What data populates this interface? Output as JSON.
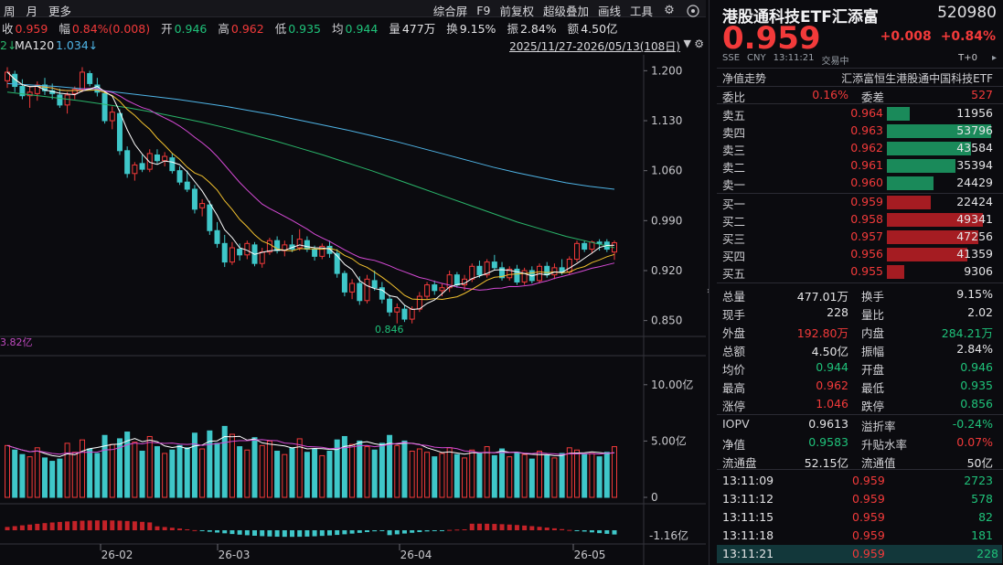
{
  "toolbar": {
    "left_items": [
      "周",
      "月",
      "更多"
    ],
    "right_items": [
      "综合屏",
      "F9",
      "前复权",
      "超级叠加",
      "画线",
      "工具"
    ],
    "icons": [
      "gear-icon",
      "settings-icon"
    ]
  },
  "quote_strip": [
    {
      "label": "收",
      "value": "0.959",
      "color": "red"
    },
    {
      "label": "幅",
      "value": "0.84%(0.008)",
      "color": "red"
    },
    {
      "label": "开",
      "value": "0.946",
      "color": "green"
    },
    {
      "label": "高",
      "value": "0.962",
      "color": "red"
    },
    {
      "label": "低",
      "value": "0.935",
      "color": "green"
    },
    {
      "label": "均",
      "value": "0.944",
      "color": "green"
    },
    {
      "label": "量",
      "value": "477万",
      "color": "white"
    },
    {
      "label": "换",
      "value": "9.15%",
      "color": "white"
    },
    {
      "label": "振",
      "value": "2.84%",
      "color": "white"
    },
    {
      "label": "额",
      "value": "4.50亿",
      "color": "white"
    }
  ],
  "ma_strip": {
    "left_fragment": "2↓",
    "ma120_label": "MA120",
    "ma120_value": "1.034↓",
    "range": "2025/11/27-2026/05/13(108日)"
  },
  "chart_data": {
    "type": "candlestick",
    "price_axis": {
      "ticks": [
        "1.200",
        "1.130",
        "1.060",
        "0.990",
        "0.920",
        "0.850"
      ],
      "min": 0.838,
      "max": 1.212
    },
    "low_label": "0.846",
    "volume_axis": {
      "ticks": [
        "10.00亿",
        "5.00亿",
        "0"
      ],
      "max": 12.5
    },
    "volume_left_label": "3.82亿",
    "macd_axis_label": "-1.16亿",
    "x_labels": [
      "26-02",
      "26-03",
      "26-04",
      "26-05"
    ],
    "candles": [
      {
        "o": 1.186,
        "h": 1.205,
        "l": 1.176,
        "c": 1.198,
        "v": 4.6
      },
      {
        "o": 1.195,
        "h": 1.2,
        "l": 1.17,
        "c": 1.178,
        "v": 4.2
      },
      {
        "o": 1.178,
        "h": 1.188,
        "l": 1.16,
        "c": 1.165,
        "v": 3.8
      },
      {
        "o": 1.165,
        "h": 1.178,
        "l": 1.148,
        "c": 1.17,
        "v": 3.6
      },
      {
        "o": 1.168,
        "h": 1.185,
        "l": 1.158,
        "c": 1.18,
        "v": 4.4
      },
      {
        "o": 1.18,
        "h": 1.19,
        "l": 1.166,
        "c": 1.172,
        "v": 3.5
      },
      {
        "o": 1.172,
        "h": 1.182,
        "l": 1.16,
        "c": 1.168,
        "v": 3.2
      },
      {
        "o": 1.166,
        "h": 1.175,
        "l": 1.148,
        "c": 1.152,
        "v": 3.4
      },
      {
        "o": 1.152,
        "h": 1.17,
        "l": 1.14,
        "c": 1.166,
        "v": 4.8
      },
      {
        "o": 1.168,
        "h": 1.178,
        "l": 1.16,
        "c": 1.174,
        "v": 4.0
      },
      {
        "o": 1.174,
        "h": 1.205,
        "l": 1.17,
        "c": 1.198,
        "v": 5.1
      },
      {
        "o": 1.196,
        "h": 1.2,
        "l": 1.178,
        "c": 1.182,
        "v": 4.3
      },
      {
        "o": 1.18,
        "h": 1.19,
        "l": 1.164,
        "c": 1.17,
        "v": 3.9
      },
      {
        "o": 1.168,
        "h": 1.172,
        "l": 1.126,
        "c": 1.13,
        "v": 5.5
      },
      {
        "o": 1.13,
        "h": 1.15,
        "l": 1.118,
        "c": 1.142,
        "v": 4.7
      },
      {
        "o": 1.14,
        "h": 1.146,
        "l": 1.082,
        "c": 1.088,
        "v": 5.2
      },
      {
        "o": 1.088,
        "h": 1.094,
        "l": 1.05,
        "c": 1.056,
        "v": 5.8
      },
      {
        "o": 1.056,
        "h": 1.072,
        "l": 1.046,
        "c": 1.068,
        "v": 4.9
      },
      {
        "o": 1.07,
        "h": 1.082,
        "l": 1.058,
        "c": 1.062,
        "v": 4.1
      },
      {
        "o": 1.062,
        "h": 1.09,
        "l": 1.058,
        "c": 1.084,
        "v": 5.4
      },
      {
        "o": 1.082,
        "h": 1.09,
        "l": 1.07,
        "c": 1.074,
        "v": 4.5
      },
      {
        "o": 1.074,
        "h": 1.086,
        "l": 1.066,
        "c": 1.08,
        "v": 3.9
      },
      {
        "o": 1.078,
        "h": 1.084,
        "l": 1.056,
        "c": 1.06,
        "v": 4.2
      },
      {
        "o": 1.06,
        "h": 1.066,
        "l": 1.04,
        "c": 1.044,
        "v": 4.6
      },
      {
        "o": 1.044,
        "h": 1.06,
        "l": 1.03,
        "c": 1.034,
        "v": 4.4
      },
      {
        "o": 1.034,
        "h": 1.04,
        "l": 1.0,
        "c": 1.006,
        "v": 5.7
      },
      {
        "o": 1.008,
        "h": 1.02,
        "l": 0.996,
        "c": 1.014,
        "v": 4.3
      },
      {
        "o": 1.012,
        "h": 1.018,
        "l": 0.97,
        "c": 0.976,
        "v": 5.9
      },
      {
        "o": 0.976,
        "h": 0.988,
        "l": 0.952,
        "c": 0.958,
        "v": 4.8
      },
      {
        "o": 0.958,
        "h": 0.97,
        "l": 0.925,
        "c": 0.932,
        "v": 6.3
      },
      {
        "o": 0.932,
        "h": 0.96,
        "l": 0.928,
        "c": 0.952,
        "v": 5.6
      },
      {
        "o": 0.95,
        "h": 0.958,
        "l": 0.934,
        "c": 0.942,
        "v": 4.5
      },
      {
        "o": 0.942,
        "h": 0.962,
        "l": 0.936,
        "c": 0.958,
        "v": 4.2
      },
      {
        "o": 0.956,
        "h": 0.96,
        "l": 0.926,
        "c": 0.93,
        "v": 5.3
      },
      {
        "o": 0.93,
        "h": 0.952,
        "l": 0.924,
        "c": 0.946,
        "v": 4.6
      },
      {
        "o": 0.946,
        "h": 0.966,
        "l": 0.942,
        "c": 0.962,
        "v": 5.0
      },
      {
        "o": 0.962,
        "h": 0.968,
        "l": 0.944,
        "c": 0.948,
        "v": 4.1
      },
      {
        "o": 0.948,
        "h": 0.962,
        "l": 0.94,
        "c": 0.956,
        "v": 3.8
      },
      {
        "o": 0.956,
        "h": 0.97,
        "l": 0.946,
        "c": 0.95,
        "v": 4.4
      },
      {
        "o": 0.952,
        "h": 0.978,
        "l": 0.948,
        "c": 0.964,
        "v": 5.2
      },
      {
        "o": 0.962,
        "h": 0.968,
        "l": 0.946,
        "c": 0.95,
        "v": 4.0
      },
      {
        "o": 0.95,
        "h": 0.955,
        "l": 0.934,
        "c": 0.94,
        "v": 4.3
      },
      {
        "o": 0.94,
        "h": 0.958,
        "l": 0.936,
        "c": 0.954,
        "v": 3.7
      },
      {
        "o": 0.954,
        "h": 0.962,
        "l": 0.938,
        "c": 0.944,
        "v": 4.1
      },
      {
        "o": 0.944,
        "h": 0.95,
        "l": 0.91,
        "c": 0.916,
        "v": 5.1
      },
      {
        "o": 0.916,
        "h": 0.92,
        "l": 0.884,
        "c": 0.89,
        "v": 5.4
      },
      {
        "o": 0.89,
        "h": 0.908,
        "l": 0.88,
        "c": 0.902,
        "v": 4.7
      },
      {
        "o": 0.902,
        "h": 0.912,
        "l": 0.872,
        "c": 0.878,
        "v": 5.0
      },
      {
        "o": 0.878,
        "h": 0.914,
        "l": 0.874,
        "c": 0.908,
        "v": 4.5
      },
      {
        "o": 0.906,
        "h": 0.92,
        "l": 0.892,
        "c": 0.896,
        "v": 4.2
      },
      {
        "o": 0.896,
        "h": 0.904,
        "l": 0.874,
        "c": 0.88,
        "v": 4.8
      },
      {
        "o": 0.88,
        "h": 0.886,
        "l": 0.856,
        "c": 0.862,
        "v": 5.5
      },
      {
        "o": 0.862,
        "h": 0.874,
        "l": 0.846,
        "c": 0.868,
        "v": 4.6
      },
      {
        "o": 0.866,
        "h": 0.872,
        "l": 0.848,
        "c": 0.852,
        "v": 5.0
      },
      {
        "o": 0.852,
        "h": 0.87,
        "l": 0.846,
        "c": 0.866,
        "v": 4.1
      },
      {
        "o": 0.866,
        "h": 0.89,
        "l": 0.862,
        "c": 0.884,
        "v": 4.3
      },
      {
        "o": 0.884,
        "h": 0.904,
        "l": 0.88,
        "c": 0.9,
        "v": 4.0
      },
      {
        "o": 0.9,
        "h": 0.906,
        "l": 0.886,
        "c": 0.892,
        "v": 3.6
      },
      {
        "o": 0.892,
        "h": 0.902,
        "l": 0.884,
        "c": 0.896,
        "v": 3.9
      },
      {
        "o": 0.896,
        "h": 0.92,
        "l": 0.89,
        "c": 0.914,
        "v": 4.4
      },
      {
        "o": 0.914,
        "h": 0.918,
        "l": 0.896,
        "c": 0.9,
        "v": 3.8
      },
      {
        "o": 0.9,
        "h": 0.914,
        "l": 0.892,
        "c": 0.908,
        "v": 3.5
      },
      {
        "o": 0.908,
        "h": 0.93,
        "l": 0.904,
        "c": 0.926,
        "v": 4.2
      },
      {
        "o": 0.926,
        "h": 0.934,
        "l": 0.91,
        "c": 0.914,
        "v": 3.9
      },
      {
        "o": 0.914,
        "h": 0.936,
        "l": 0.91,
        "c": 0.932,
        "v": 4.5
      },
      {
        "o": 0.932,
        "h": 0.942,
        "l": 0.92,
        "c": 0.924,
        "v": 3.7
      },
      {
        "o": 0.924,
        "h": 0.932,
        "l": 0.906,
        "c": 0.91,
        "v": 4.3
      },
      {
        "o": 0.91,
        "h": 0.926,
        "l": 0.906,
        "c": 0.922,
        "v": 3.6
      },
      {
        "o": 0.922,
        "h": 0.928,
        "l": 0.9,
        "c": 0.904,
        "v": 4.0
      },
      {
        "o": 0.904,
        "h": 0.924,
        "l": 0.9,
        "c": 0.92,
        "v": 3.8
      },
      {
        "o": 0.92,
        "h": 0.926,
        "l": 0.902,
        "c": 0.906,
        "v": 3.4
      },
      {
        "o": 0.906,
        "h": 0.93,
        "l": 0.902,
        "c": 0.926,
        "v": 4.1
      },
      {
        "o": 0.926,
        "h": 0.932,
        "l": 0.91,
        "c": 0.914,
        "v": 3.7
      },
      {
        "o": 0.914,
        "h": 0.93,
        "l": 0.908,
        "c": 0.924,
        "v": 3.5
      },
      {
        "o": 0.924,
        "h": 0.936,
        "l": 0.914,
        "c": 0.918,
        "v": 3.9
      },
      {
        "o": 0.918,
        "h": 0.94,
        "l": 0.914,
        "c": 0.936,
        "v": 4.4
      },
      {
        "o": 0.936,
        "h": 0.962,
        "l": 0.932,
        "c": 0.958,
        "v": 4.2
      },
      {
        "o": 0.958,
        "h": 0.962,
        "l": 0.946,
        "c": 0.95,
        "v": 3.8
      },
      {
        "o": 0.95,
        "h": 0.962,
        "l": 0.944,
        "c": 0.96,
        "v": 3.9
      },
      {
        "o": 0.96,
        "h": 0.964,
        "l": 0.948,
        "c": 0.958,
        "v": 3.6
      },
      {
        "o": 0.96,
        "h": 0.964,
        "l": 0.946,
        "c": 0.95,
        "v": 4.0
      },
      {
        "o": 0.946,
        "h": 0.962,
        "l": 0.935,
        "c": 0.959,
        "v": 4.5
      }
    ],
    "ma_series": [
      {
        "name": "MA5",
        "color": "#ffffff"
      },
      {
        "name": "MA10",
        "color": "#f2c12e"
      },
      {
        "name": "MA20",
        "color": "#d54ad5"
      },
      {
        "name": "MA60",
        "color": "#2ab56a"
      },
      {
        "name": "MA120",
        "color": "#4fb4e6"
      }
    ],
    "ma60_points": [
      1.17,
      1.166,
      1.162,
      1.158,
      1.153,
      1.148,
      1.142,
      1.135,
      1.128,
      1.12,
      1.111,
      1.102,
      1.092,
      1.082,
      1.071,
      1.06,
      1.048,
      1.036,
      1.024,
      1.012,
      1.0,
      0.988,
      0.978,
      0.968,
      0.96,
      0.952
    ],
    "ma120_points": [
      1.182,
      1.18,
      1.178,
      1.175,
      1.172,
      1.168,
      1.164,
      1.16,
      1.155,
      1.15,
      1.144,
      1.138,
      1.131,
      1.124,
      1.117,
      1.109,
      1.101,
      1.092,
      1.083,
      1.074,
      1.065,
      1.057,
      1.05,
      1.043,
      1.038,
      1.034
    ]
  },
  "panel": {
    "name": "港股通科技ETF汇添富",
    "code": "520980",
    "price": "0.959",
    "change": "+0.008",
    "change_pct": "+0.84%",
    "meta": [
      "SSE",
      "CNY",
      "13:11:21",
      "交易中",
      "T+0",
      "▸"
    ],
    "net_label": "净值走势",
    "net_index": "汇添富恒生港股通中国科技ETF",
    "commission": {
      "label1": "委比",
      "value1": "0.16%",
      "label2": "委差",
      "value2": "527"
    },
    "asks": [
      {
        "label": "卖五",
        "price": "0.964",
        "volume": "11956",
        "bar": 0.22
      },
      {
        "label": "卖四",
        "price": "0.963",
        "volume": "53796",
        "bar": 1.0
      },
      {
        "label": "卖三",
        "price": "0.962",
        "volume": "43584",
        "bar": 0.81
      },
      {
        "label": "卖二",
        "price": "0.961",
        "volume": "35394",
        "bar": 0.66
      },
      {
        "label": "卖一",
        "price": "0.960",
        "volume": "24429",
        "bar": 0.45
      }
    ],
    "bids": [
      {
        "label": "买一",
        "price": "0.959",
        "volume": "22424",
        "bar": 0.42
      },
      {
        "label": "买二",
        "price": "0.958",
        "volume": "49341",
        "bar": 0.92
      },
      {
        "label": "买三",
        "price": "0.957",
        "volume": "47256",
        "bar": 0.88
      },
      {
        "label": "买四",
        "price": "0.956",
        "volume": "41359",
        "bar": 0.77
      },
      {
        "label": "买五",
        "price": "0.955",
        "volume": "9306",
        "bar": 0.17
      }
    ],
    "stats": [
      {
        "l1": "总量",
        "v1": "477.01万",
        "c1": "white",
        "l2": "换手",
        "v2": "9.15%",
        "c2": "white"
      },
      {
        "l1": "现手",
        "v1": "228",
        "c1": "white",
        "l2": "量比",
        "v2": "2.02",
        "c2": "white"
      },
      {
        "l1": "外盘",
        "v1": "192.80万",
        "c1": "red",
        "l2": "内盘",
        "v2": "284.21万",
        "c2": "green"
      },
      {
        "l1": "总额",
        "v1": "4.50亿",
        "c1": "white",
        "l2": "振幅",
        "v2": "2.84%",
        "c2": "white"
      },
      {
        "l1": "均价",
        "v1": "0.944",
        "c1": "green",
        "l2": "开盘",
        "v2": "0.946",
        "c2": "green"
      },
      {
        "l1": "最高",
        "v1": "0.962",
        "c1": "red",
        "l2": "最低",
        "v2": "0.935",
        "c2": "green"
      },
      {
        "l1": "涨停",
        "v1": "1.046",
        "c1": "red",
        "l2": "跌停",
        "v2": "0.856",
        "c2": "green"
      }
    ],
    "iopv": [
      {
        "l1": "IOPV",
        "v1": "0.9613",
        "c1": "white",
        "l2": "溢折率",
        "v2": "-0.24%",
        "c2": "green"
      },
      {
        "l1": "净值",
        "v1": "0.9583",
        "c1": "green",
        "l2": "升贴水率",
        "v2": "0.07%",
        "c2": "red"
      },
      {
        "l1": "流通盘",
        "v1": "52.15亿",
        "c1": "white",
        "l2": "流通值",
        "v2": "50亿",
        "c2": "white"
      }
    ],
    "ticks": [
      {
        "time": "13:11:09",
        "price": "0.959",
        "vol": "2723"
      },
      {
        "time": "13:11:12",
        "price": "0.959",
        "vol": "578"
      },
      {
        "time": "13:11:15",
        "price": "0.959",
        "vol": "82"
      },
      {
        "time": "13:11:18",
        "price": "0.959",
        "vol": "181"
      },
      {
        "time": "13:11:21",
        "price": "0.959",
        "vol": "228"
      }
    ]
  }
}
